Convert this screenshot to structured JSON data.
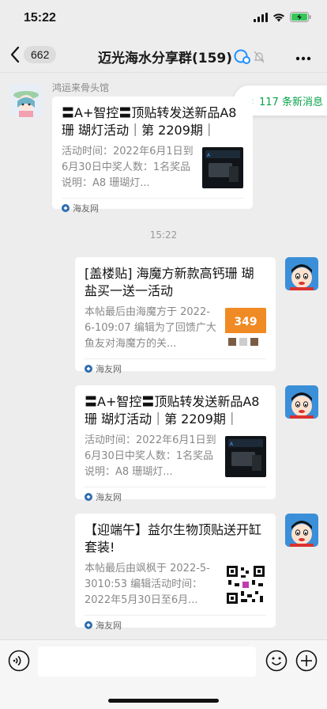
{
  "status_bar": {
    "time": "15:22"
  },
  "nav": {
    "unread_count": "662",
    "title": "迈光海水分享群(159)"
  },
  "new_messages": {
    "label": "117 条新消息"
  },
  "timestamp": "15:22",
  "messages": [
    {
      "sender": "鸿运来骨头馆",
      "title": "〓A+智控〓顶贴转发送新品A8珊 瑚灯活动｜第 2209期｜",
      "desc": "活动时间：2022年6月1日到6月30日中奖人数：1名奖品说明：A8 珊瑚灯...",
      "source": "海友网",
      "thumb_icon": "product-thumb-icon"
    },
    {
      "title": "[盖楼贴] 海魔方新款高钙珊 瑚盐买一送一活动",
      "desc": "本帖最后由海魔方于 2022-6-109:07 编辑为了回馈广大鱼友对海魔方的关...",
      "source": "海友网",
      "thumb_text": "349"
    },
    {
      "title": "〓A+智控〓顶贴转发送新品A8珊 瑚灯活动｜第 2209期｜",
      "desc": "活动时间：2022年6月1日到6月30日中奖人数：1名奖品说明：A8 珊瑚灯...",
      "source": "海友网"
    },
    {
      "title": "【迎端午】益尔生物顶贴送开缸套装!",
      "desc": "本帖最后由飒枫于 2022-5-3010:53 编辑活动时间：2022年5月30日至6月...",
      "source": "海友网"
    }
  ],
  "colors": {
    "accent_green": "#07a34a",
    "background": "#ededed",
    "bubble": "#ffffff"
  }
}
